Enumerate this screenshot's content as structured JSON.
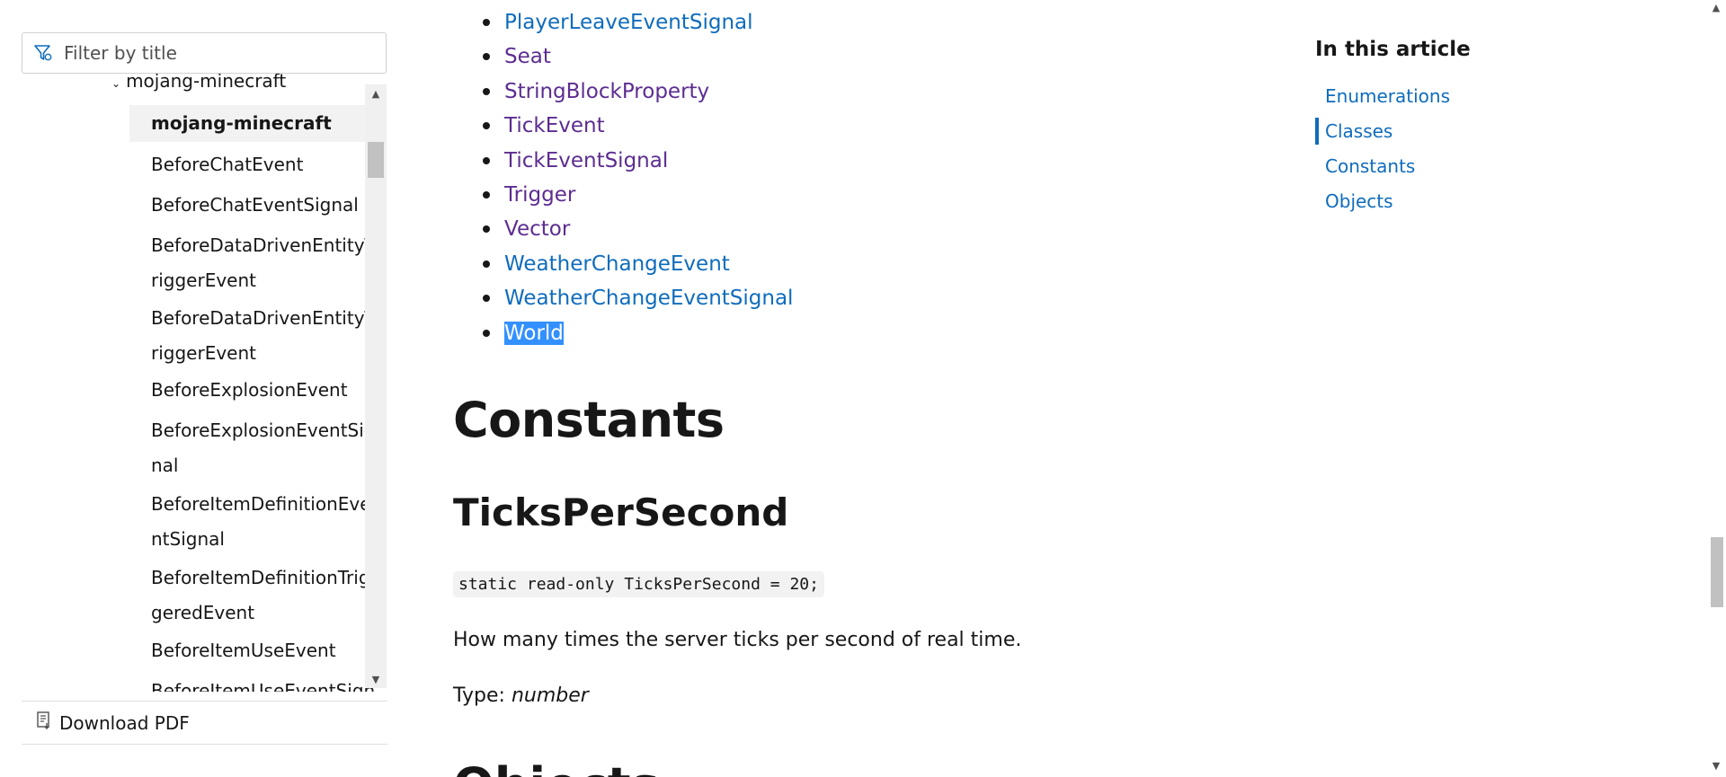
{
  "sidebar": {
    "filter_placeholder": "Filter by title",
    "tree_parent": "mojang-minecraft",
    "tree_items": [
      "mojang-minecraft",
      "BeforeChatEvent",
      "BeforeChatEventSignal",
      "BeforeDataDrivenEntityTriggerEvent",
      "BeforeDataDrivenEntityTriggerEvent",
      "BeforeExplosionEvent",
      "BeforeExplosionEventSignal",
      "BeforeItemDefinitionEventSignal",
      "BeforeItemDefinitionTriggeredEvent",
      "BeforeItemUseEvent",
      "BeforeItemUseEventSignal"
    ],
    "download_label": "Download PDF"
  },
  "main": {
    "classes": [
      {
        "label": "PlayerLeaveEventSignal",
        "visited": false
      },
      {
        "label": "Seat",
        "visited": true
      },
      {
        "label": "StringBlockProperty",
        "visited": true
      },
      {
        "label": "TickEvent",
        "visited": true
      },
      {
        "label": "TickEventSignal",
        "visited": true
      },
      {
        "label": "Trigger",
        "visited": true
      },
      {
        "label": "Vector",
        "visited": true
      },
      {
        "label": "WeatherChangeEvent",
        "visited": false
      },
      {
        "label": "WeatherChangeEventSignal",
        "visited": false
      },
      {
        "label": "World",
        "visited": false,
        "selected": true
      }
    ],
    "section_heading": "Constants",
    "sub_heading": "TicksPerSecond",
    "code": "static read-only TicksPerSecond = 20;",
    "description": "How many times the server ticks per second of real time.",
    "type_label": "Type:",
    "type_value": "number",
    "next_heading": "Objects"
  },
  "toc": {
    "title": "In this article",
    "items": [
      "Enumerations",
      "Classes",
      "Constants",
      "Objects"
    ],
    "active_index": 1
  },
  "colors": {
    "link": "#0f6cbd",
    "visited_link": "#5c2d91",
    "selection": "#3390ff"
  }
}
